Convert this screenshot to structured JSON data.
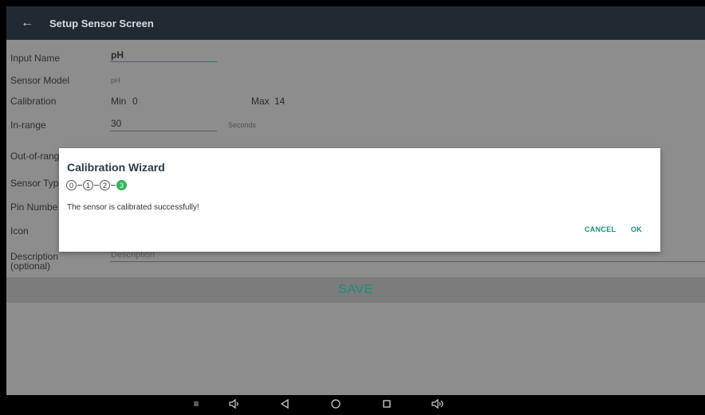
{
  "appbar": {
    "title": "Setup Sensor Screen",
    "back_icon": "back-arrow-icon"
  },
  "form": {
    "input_name": {
      "label": "Input Name",
      "value": "pH"
    },
    "sensor_model": {
      "label": "Sensor Model",
      "value": "pH"
    },
    "calibration": {
      "label": "Calibration",
      "min_label": "Min",
      "min_value": "0",
      "max_label": "Max",
      "max_value": "14"
    },
    "in_range": {
      "label": "In-range",
      "value": "30",
      "unit": "Seconds"
    },
    "out_of_range": {
      "label": "Out-of-rang"
    },
    "sensor_type": {
      "label": "Sensor Typ"
    },
    "pin_number": {
      "label": "Pin Numbe"
    },
    "icon": {
      "label": "Icon"
    },
    "description": {
      "label_line1": "Description",
      "label_line2": "(optional)",
      "placeholder": "Description"
    },
    "save_label": "SAVE"
  },
  "dialog": {
    "title": "Calibration Wizard",
    "steps": [
      "0",
      "1",
      "2",
      "3"
    ],
    "active_step": "3",
    "message": "The sensor is calibrated successfully!",
    "cancel_label": "CANCEL",
    "ok_label": "OK"
  },
  "navbar": {
    "icons": [
      "collapse-icon",
      "volume-down-icon",
      "back-icon",
      "home-icon",
      "recents-icon",
      "volume-up-icon"
    ]
  },
  "colors": {
    "accent": "#13907e",
    "appbar": "#212a33",
    "step_active": "#35b35a"
  }
}
